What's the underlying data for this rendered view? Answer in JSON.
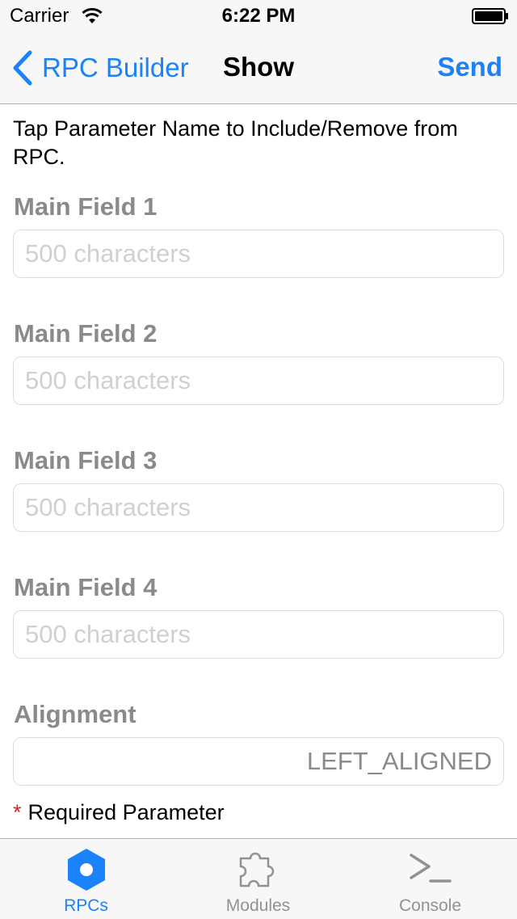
{
  "status": {
    "carrier": "Carrier",
    "time": "6:22 PM"
  },
  "nav": {
    "back_label": "RPC Builder",
    "title": "Show",
    "send_label": "Send"
  },
  "instructions": "Tap Parameter Name to Include/Remove from RPC.",
  "fields": [
    {
      "label": "Main Field 1",
      "placeholder": "500 characters"
    },
    {
      "label": "Main Field 2",
      "placeholder": "500 characters"
    },
    {
      "label": "Main Field 3",
      "placeholder": "500 characters"
    },
    {
      "label": "Main Field 4",
      "placeholder": "500 characters"
    }
  ],
  "alignment": {
    "label": "Alignment",
    "value": "LEFT_ALIGNED"
  },
  "required_note": {
    "star": "*",
    "text": "Required Parameter"
  },
  "tabs": [
    {
      "label": "RPCs",
      "icon": "hexagon-icon",
      "active": true
    },
    {
      "label": "Modules",
      "icon": "puzzle-icon",
      "active": false
    },
    {
      "label": "Console",
      "icon": "terminal-icon",
      "active": false
    }
  ],
  "colors": {
    "accent": "#1a82fb",
    "inactive": "#929292",
    "label_gray": "#8a8a8a",
    "required_star": "#e02020"
  }
}
